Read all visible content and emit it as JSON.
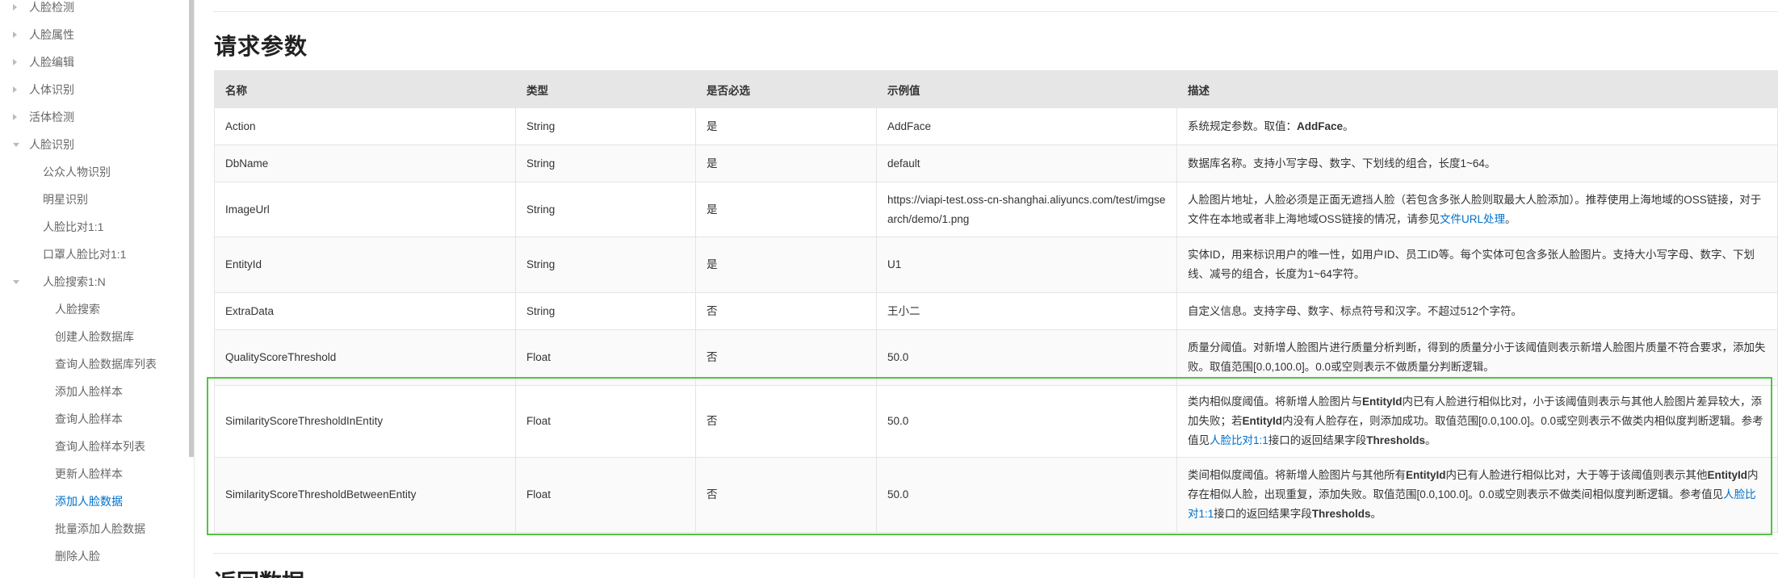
{
  "sidebar": {
    "items": [
      {
        "label": "人脸检测",
        "level": 0,
        "caret": "right"
      },
      {
        "label": "人脸属性",
        "level": 0,
        "caret": "right"
      },
      {
        "label": "人脸编辑",
        "level": 0,
        "caret": "right"
      },
      {
        "label": "人体识别",
        "level": 0,
        "caret": "right"
      },
      {
        "label": "活体检测",
        "level": 0,
        "caret": "right"
      },
      {
        "label": "人脸识别",
        "level": 0,
        "caret": "down"
      },
      {
        "label": "公众人物识别",
        "level": 1,
        "caret": ""
      },
      {
        "label": "明星识别",
        "level": 1,
        "caret": ""
      },
      {
        "label": "人脸比对1:1",
        "level": 1,
        "caret": ""
      },
      {
        "label": "口罩人脸比对1:1",
        "level": 1,
        "caret": ""
      },
      {
        "label": "人脸搜索1:N",
        "level": 1,
        "caret": "down"
      },
      {
        "label": "人脸搜索",
        "level": 2,
        "caret": ""
      },
      {
        "label": "创建人脸数据库",
        "level": 2,
        "caret": ""
      },
      {
        "label": "查询人脸数据库列表",
        "level": 2,
        "caret": ""
      },
      {
        "label": "添加人脸样本",
        "level": 2,
        "caret": ""
      },
      {
        "label": "查询人脸样本",
        "level": 2,
        "caret": ""
      },
      {
        "label": "查询人脸样本列表",
        "level": 2,
        "caret": ""
      },
      {
        "label": "更新人脸样本",
        "level": 2,
        "caret": ""
      },
      {
        "label": "添加人脸数据",
        "level": 2,
        "caret": "",
        "active": true
      },
      {
        "label": "批量添加人脸数据",
        "level": 2,
        "caret": ""
      },
      {
        "label": "删除人脸",
        "level": 2,
        "caret": ""
      }
    ]
  },
  "main": {
    "section_title": "请求参数",
    "next_section_title": "返回数据",
    "table": {
      "headers": [
        "名称",
        "类型",
        "是否必选",
        "示例值",
        "描述"
      ],
      "rows": [
        {
          "name": "Action",
          "type": "String",
          "required": "是",
          "example": "AddFace",
          "desc": [
            {
              "t": "系统规定参数。取值："
            },
            {
              "t": "AddFace",
              "b": true
            },
            {
              "t": "。"
            }
          ]
        },
        {
          "name": "DbName",
          "type": "String",
          "required": "是",
          "example": "default",
          "desc": [
            {
              "t": "数据库名称。支持小写字母、数字、下划线的组合，长度1~64。"
            }
          ]
        },
        {
          "name": "ImageUrl",
          "type": "String",
          "required": "是",
          "example": "https://viapi-test.oss-cn-shanghai.aliyuncs.com/test/imgsearch/demo/1.png",
          "desc": [
            {
              "t": "人脸图片地址，人脸必须是正面无遮挡人脸（若包含多张人脸则取最大人脸添加）。推荐使用上海地域的OSS链接，对于文件在本地或者非上海地域OSS链接的情况，请参见"
            },
            {
              "t": "文件URL处理",
              "link": true
            },
            {
              "t": "。"
            }
          ]
        },
        {
          "name": "EntityId",
          "type": "String",
          "required": "是",
          "example": "U1",
          "desc": [
            {
              "t": "实体ID，用来标识用户的唯一性，如用户ID、员工ID等。每个实体可包含多张人脸图片。支持大小写字母、数字、下划线、减号的组合，长度为1~64字符。"
            }
          ]
        },
        {
          "name": "ExtraData",
          "type": "String",
          "required": "否",
          "example": "王小二",
          "desc": [
            {
              "t": "自定义信息。支持字母、数字、标点符号和汉字。不超过512个字符。"
            }
          ]
        },
        {
          "name": "QualityScoreThreshold",
          "type": "Float",
          "required": "否",
          "example": "50.0",
          "desc": [
            {
              "t": "质量分阈值。对新增人脸图片进行质量分析判断，得到的质量分小于该阈值则表示新增人脸图片质量不符合要求，添加失败。取值范围[0.0,100.0]。0.0或空则表示不做质量分判断逻辑。"
            }
          ]
        },
        {
          "name": "SimilarityScoreThresholdInEntity",
          "type": "Float",
          "required": "否",
          "example": "50.0",
          "desc": [
            {
              "t": "类内相似度阈值。将新增人脸图片与"
            },
            {
              "t": "EntityId",
              "b": true
            },
            {
              "t": "内已有人脸进行相似比对，小于该阈值则表示与其他人脸图片差异较大，添加失败；若"
            },
            {
              "t": "EntityId",
              "b": true
            },
            {
              "t": "内没有人脸存在，则添加成功。取值范围[0.0,100.0]。0.0或空则表示不做类内相似度判断逻辑。参考值见"
            },
            {
              "t": "人脸比对1:1",
              "link": true
            },
            {
              "t": "接口的返回结果字段"
            },
            {
              "t": "Thresholds",
              "b": true
            },
            {
              "t": "。"
            }
          ]
        },
        {
          "name": "SimilarityScoreThresholdBetweenEntity",
          "type": "Float",
          "required": "否",
          "example": "50.0",
          "desc": [
            {
              "t": "类间相似度阈值。将新增人脸图片与其他所有"
            },
            {
              "t": "EntityId",
              "b": true
            },
            {
              "t": "内已有人脸进行相似比对，大于等于该阈值则表示其他"
            },
            {
              "t": "EntityId",
              "b": true
            },
            {
              "t": "内存在相似人脸，出现重复，添加失败。取值范围[0.0,100.0]。0.0或空则表示不做类间相似度判断逻辑。参考值见"
            },
            {
              "t": "人脸比对1:1",
              "link": true
            },
            {
              "t": "接口的返回结果字段"
            },
            {
              "t": "Thresholds",
              "b": true
            },
            {
              "t": "。"
            }
          ]
        }
      ]
    },
    "colors": {
      "accent": "#0070cc",
      "highlight": "#52c441",
      "header_bg": "#e6e6e6"
    }
  }
}
